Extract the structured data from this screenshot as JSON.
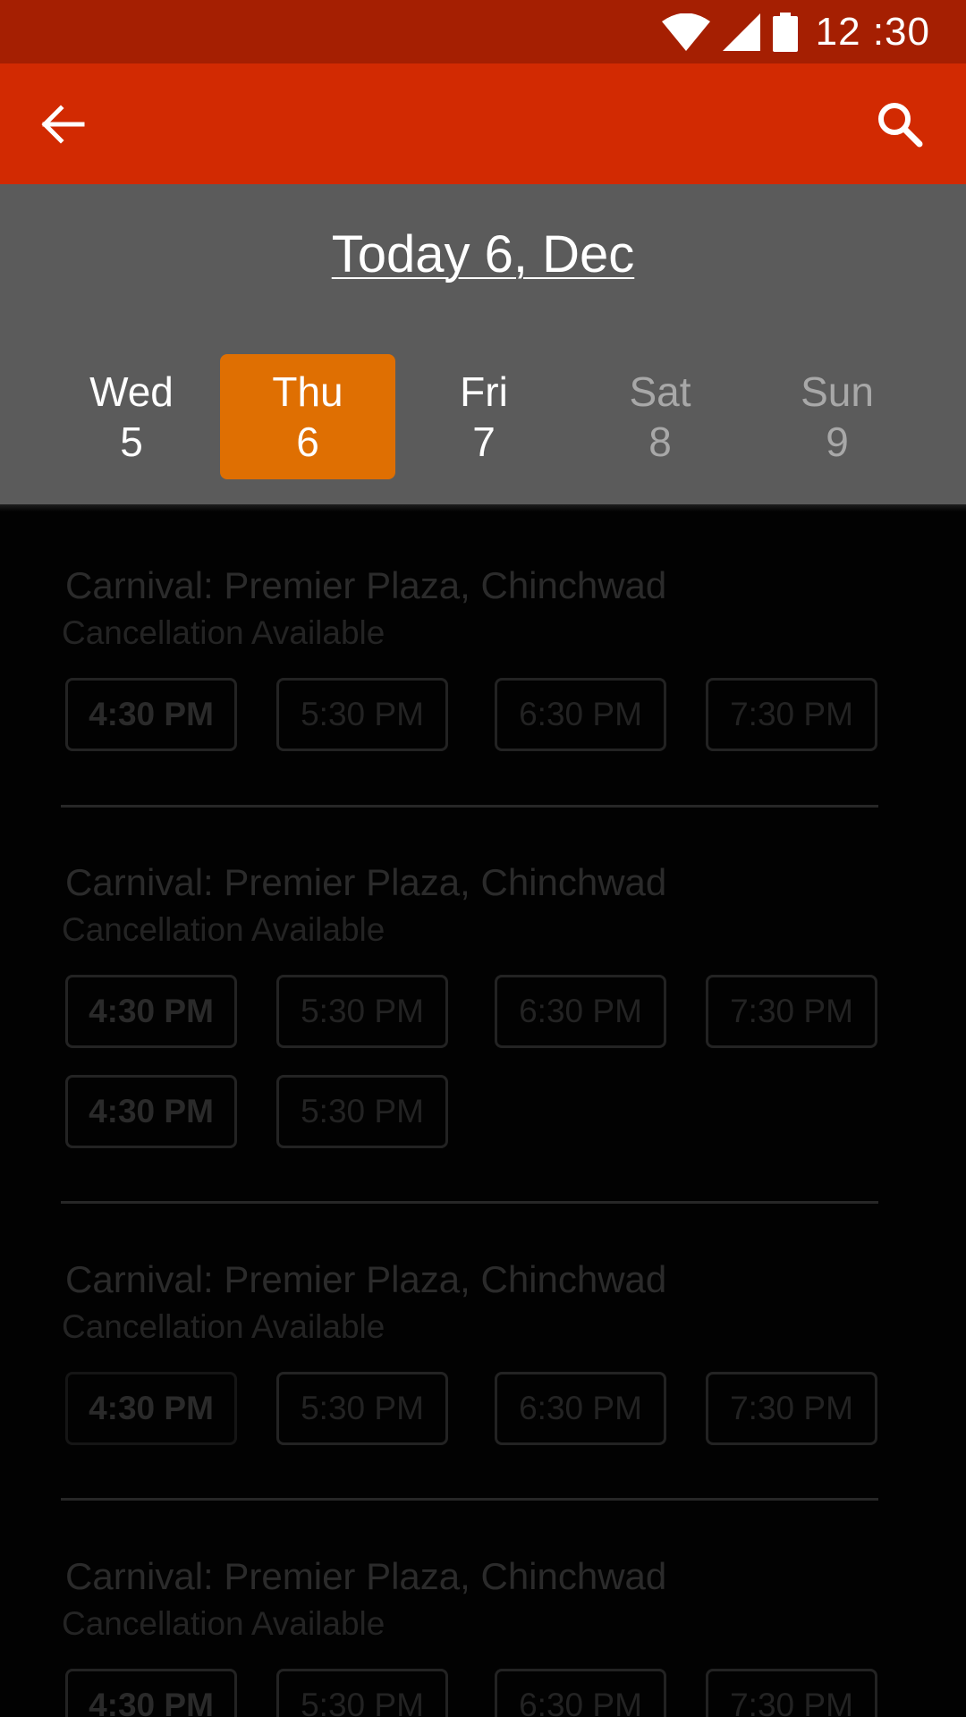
{
  "status_bar": {
    "time": "12 :30",
    "icons": [
      "wifi-icon",
      "signal-icon",
      "battery-icon"
    ]
  },
  "toolbar": {
    "back_icon": "arrow-left-icon",
    "search_icon": "search-icon"
  },
  "date_header": {
    "title": "Today 6, Dec",
    "days": [
      {
        "name": "Wed",
        "num": "5",
        "state": "normal"
      },
      {
        "name": "Thu",
        "num": "6",
        "state": "selected"
      },
      {
        "name": "Fri",
        "num": "7",
        "state": "normal"
      },
      {
        "name": "Sat",
        "num": "8",
        "state": "dim"
      },
      {
        "name": "Sun",
        "num": "9",
        "state": "dim"
      }
    ]
  },
  "theaters": [
    {
      "name": "Carnival: Premier Plaza, Chinchwad",
      "subtitle": "Cancellation Available",
      "times": [
        "4:30 PM",
        "5:30 PM",
        "6:30 PM",
        "7:30 PM"
      ]
    },
    {
      "name": "Carnival: Premier Plaza, Chinchwad",
      "subtitle": "Cancellation Available",
      "times": [
        "4:30 PM",
        "5:30 PM",
        "6:30 PM",
        "7:30 PM",
        "4:30 PM",
        "5:30 PM"
      ]
    },
    {
      "name": "Carnival: Premier Plaza, Chinchwad",
      "subtitle": "Cancellation Available",
      "times": [
        "4:30 PM",
        "5:30 PM",
        "6:30 PM",
        "7:30 PM"
      ]
    },
    {
      "name": "Carnival: Premier Plaza, Chinchwad",
      "subtitle": "Cancellation Available",
      "times": [
        "4:30 PM",
        "5:30 PM",
        "6:30 PM",
        "7:30 PM"
      ]
    }
  ],
  "colors": {
    "status_bar": "#a51f02",
    "toolbar": "#d22a02",
    "header": "#5b5b5b",
    "selected_day": "#df6f02",
    "background": "#020202"
  }
}
